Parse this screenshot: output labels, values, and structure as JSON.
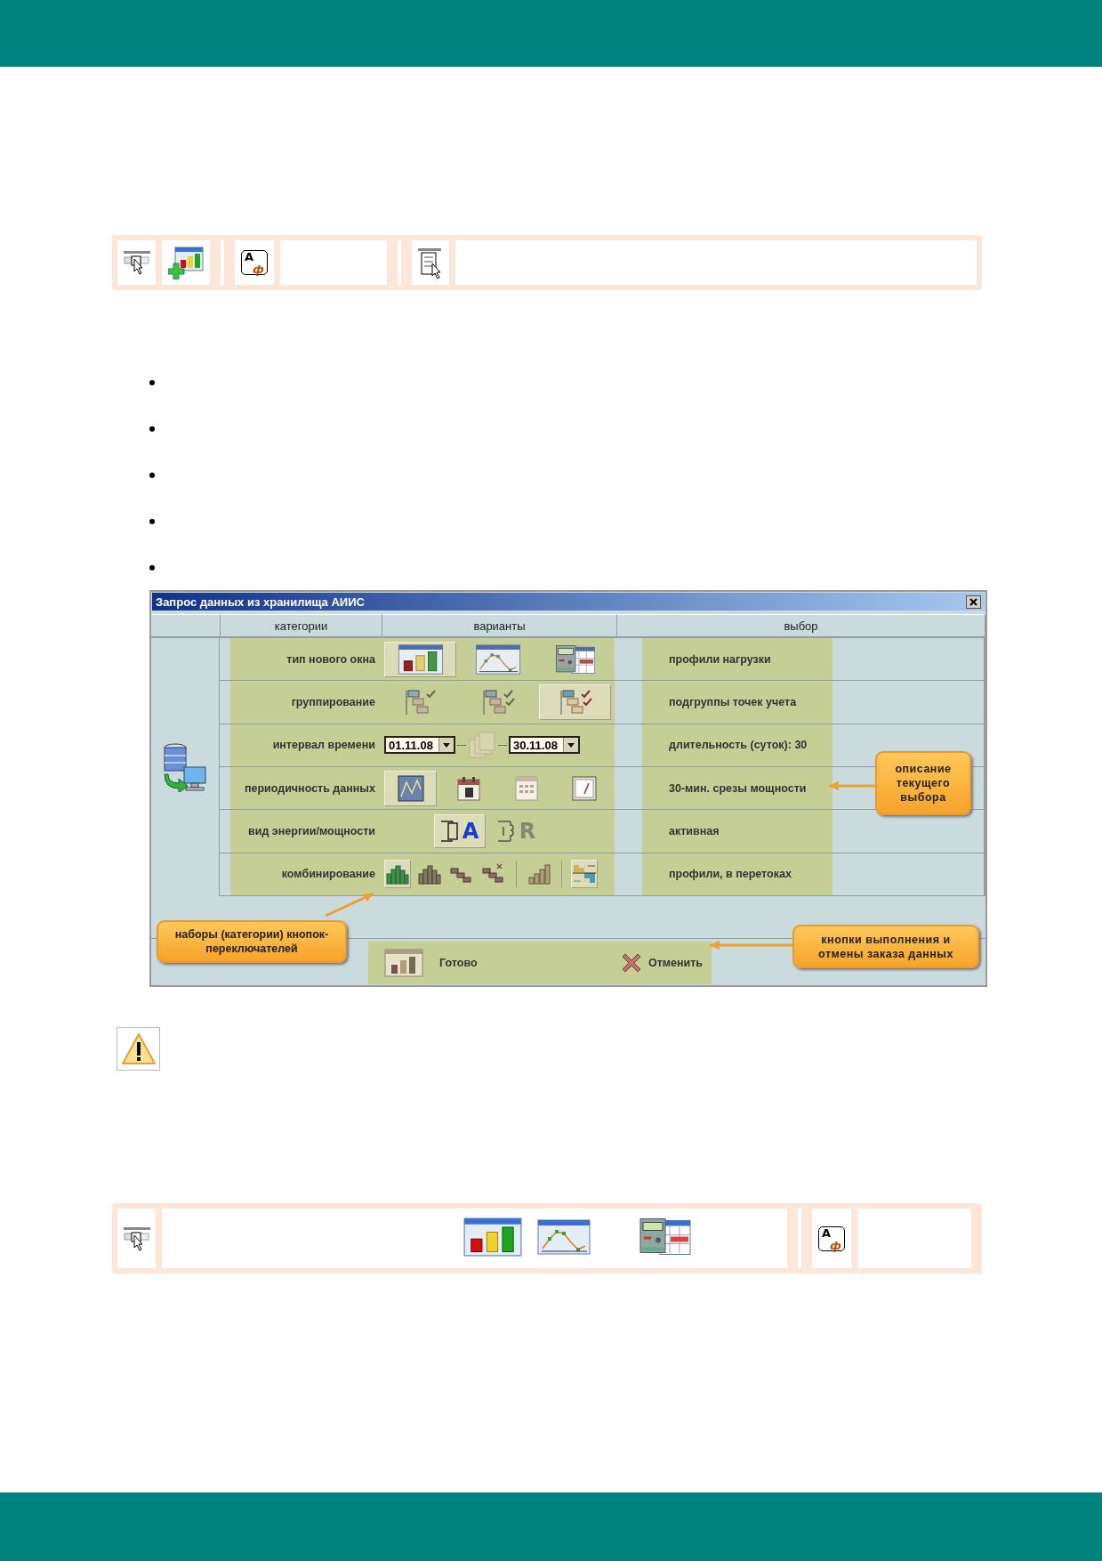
{
  "toolbars": [
    {
      "cells": [
        {
          "kind": "select"
        },
        {
          "kind": "addchart"
        },
        {
          "kind": "sep"
        },
        {
          "kind": "font",
          "glyphs": [
            "A",
            "ф"
          ]
        },
        {
          "kind": "blank"
        },
        {
          "kind": "sep"
        },
        {
          "kind": "listpick"
        },
        {
          "kind": "wide"
        }
      ]
    },
    {
      "cells": [
        {
          "kind": "select"
        },
        {
          "kind": "charts"
        },
        {
          "kind": "sep"
        },
        {
          "kind": "font",
          "glyphs": [
            "A",
            "ф"
          ]
        },
        {
          "kind": "blank"
        }
      ]
    }
  ],
  "dialog": {
    "title": "Запрос данных из хранилища АИИС",
    "columns": [
      "категории",
      "варианты",
      "выбор"
    ],
    "rows": [
      {
        "category": "тип нового окна",
        "kind": "icons",
        "choice": "профили нагрузки",
        "variants": [
          {
            "kind": "toggle",
            "selected": true
          },
          {
            "kind": "toggle",
            "selected": false
          },
          {
            "kind": "toggle",
            "selected": false
          }
        ]
      },
      {
        "category": "группирование",
        "kind": "icons",
        "choice": "подгруппы точек учета",
        "variants": [
          {
            "kind": "toggle",
            "selected": false
          },
          {
            "kind": "toggle",
            "selected": false
          },
          {
            "kind": "toggle",
            "selected": true
          }
        ]
      },
      {
        "category": "интервал времени",
        "kind": "dates",
        "choice": "длительность (суток): 30",
        "variants": [
          {
            "kind": "date",
            "value": "01.11.08"
          },
          {
            "kind": "range"
          },
          {
            "kind": "date",
            "value": "30.11.08"
          }
        ]
      },
      {
        "category": "периодичность данных",
        "kind": "icons",
        "choice": "30-мин. срезы мощности",
        "variants": [
          {
            "kind": "toggle",
            "selected": true
          },
          {
            "kind": "toggle",
            "selected": false
          },
          {
            "kind": "toggle",
            "selected": false
          },
          {
            "kind": "toggle",
            "selected": false
          }
        ]
      },
      {
        "category": "вид энергии/мощности",
        "kind": "letters",
        "choice": "активная",
        "variants": [
          {
            "kind": "toggle",
            "label": "A",
            "selected": true
          },
          {
            "kind": "toggle",
            "label": "R",
            "selected": false
          }
        ]
      },
      {
        "category": "комбинирование",
        "kind": "combo",
        "choice": "профили, в перетоках",
        "variants": [
          {
            "kind": "toggle",
            "selected": true
          },
          {
            "kind": "toggle",
            "selected": false
          },
          {
            "kind": "toggle",
            "selected": false
          },
          {
            "kind": "toggle",
            "selected": false
          },
          {
            "kind": "sep"
          },
          {
            "kind": "toggle",
            "selected": false
          },
          {
            "kind": "sep"
          },
          {
            "kind": "toggle",
            "selected": true
          }
        ]
      }
    ],
    "buttons": [
      {
        "kind": "done",
        "label": "Готово"
      },
      {
        "kind": "cancel",
        "label": "Отменить"
      }
    ],
    "callouts": [
      "описание текущего выбора",
      "наборы (категории) кнопок-переключателей",
      "кнопки выполнения и отмены заказа данных"
    ]
  }
}
